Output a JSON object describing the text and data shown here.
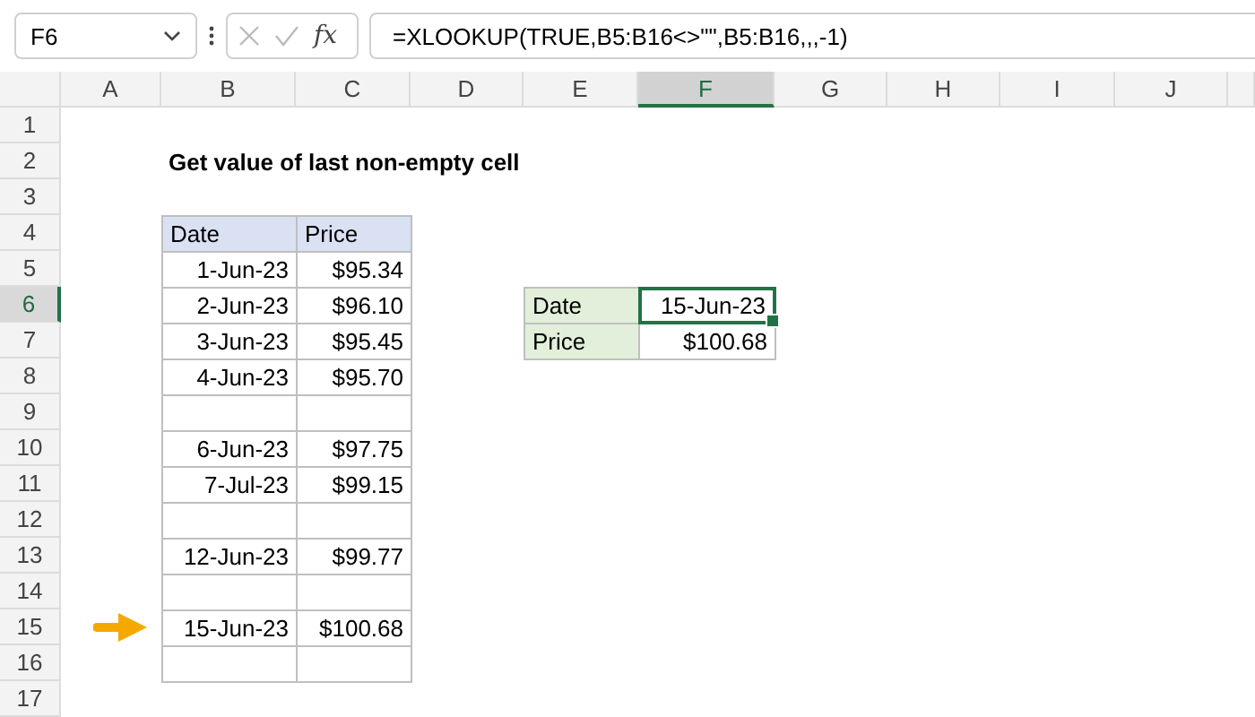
{
  "name_box": {
    "value": "F6"
  },
  "formula_bar": {
    "function_label": "fx",
    "formula": "=XLOOKUP(TRUE,B5:B16<>\"\",B5:B16,,,-1)"
  },
  "columns": [
    {
      "label": "A",
      "selected": false
    },
    {
      "label": "B",
      "selected": false
    },
    {
      "label": "C",
      "selected": false
    },
    {
      "label": "D",
      "selected": false
    },
    {
      "label": "E",
      "selected": false
    },
    {
      "label": "F",
      "selected": true
    },
    {
      "label": "G",
      "selected": false
    },
    {
      "label": "H",
      "selected": false
    },
    {
      "label": "I",
      "selected": false
    },
    {
      "label": "J",
      "selected": false
    }
  ],
  "rows": [
    {
      "label": "1",
      "selected": false
    },
    {
      "label": "2",
      "selected": false
    },
    {
      "label": "3",
      "selected": false
    },
    {
      "label": "4",
      "selected": false
    },
    {
      "label": "5",
      "selected": false
    },
    {
      "label": "6",
      "selected": true
    },
    {
      "label": "7",
      "selected": false
    },
    {
      "label": "8",
      "selected": false
    },
    {
      "label": "9",
      "selected": false
    },
    {
      "label": "10",
      "selected": false
    },
    {
      "label": "11",
      "selected": false
    },
    {
      "label": "12",
      "selected": false
    },
    {
      "label": "13",
      "selected": false
    },
    {
      "label": "14",
      "selected": false
    },
    {
      "label": "15",
      "selected": false
    },
    {
      "label": "16",
      "selected": false
    },
    {
      "label": "17",
      "selected": false
    }
  ],
  "title": "Get value of last non-empty cell",
  "table": {
    "columns": [
      "Date",
      "Price"
    ],
    "rows": [
      {
        "date": "1-Jun-23",
        "price": "$95.34"
      },
      {
        "date": "2-Jun-23",
        "price": "$96.10"
      },
      {
        "date": "3-Jun-23",
        "price": "$95.45"
      },
      {
        "date": "4-Jun-23",
        "price": "$95.70"
      },
      {},
      {
        "date": "6-Jun-23",
        "price": "$97.75"
      },
      {
        "date": "7-Jul-23",
        "price": "$99.15"
      },
      {},
      {
        "date": "12-Jun-23",
        "price": "$99.77"
      },
      {},
      {
        "date": "15-Jun-23",
        "price": "$100.68",
        "marked": true
      },
      {}
    ]
  },
  "result": [
    {
      "label": "Date",
      "value": "15-Jun-23",
      "selected": true
    },
    {
      "label": "Price",
      "value": "$100.68",
      "selected": false
    }
  ]
}
